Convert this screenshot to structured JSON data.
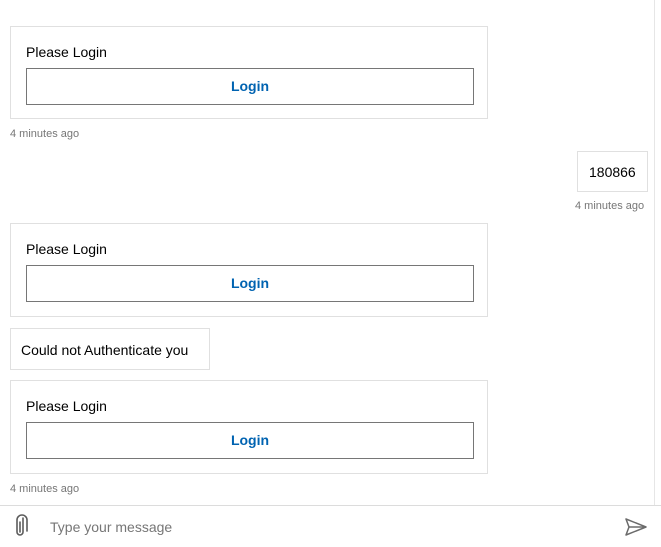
{
  "activities": [
    {
      "type": "card",
      "text": "Please Login",
      "button_label": "Login"
    },
    {
      "type": "timestamp",
      "text": "4 minutes ago"
    },
    {
      "type": "user_message",
      "text": "180866"
    },
    {
      "type": "timestamp",
      "text": "4 minutes ago"
    },
    {
      "type": "card",
      "text": "Please Login",
      "button_label": "Login"
    },
    {
      "type": "bot_message",
      "text": "Could not Authenticate you"
    },
    {
      "type": "card",
      "text": "Please Login",
      "button_label": "Login"
    },
    {
      "type": "timestamp",
      "text": "4 minutes ago"
    }
  ],
  "input_bar": {
    "placeholder": "Type your message",
    "value": "",
    "attach_icon": "paperclip-icon",
    "send_icon": "send-icon"
  },
  "colors": {
    "button_text": "#0063b1",
    "timestamp_text": "#767676",
    "card_border": "#e0e0e0",
    "button_border": "#767676"
  }
}
